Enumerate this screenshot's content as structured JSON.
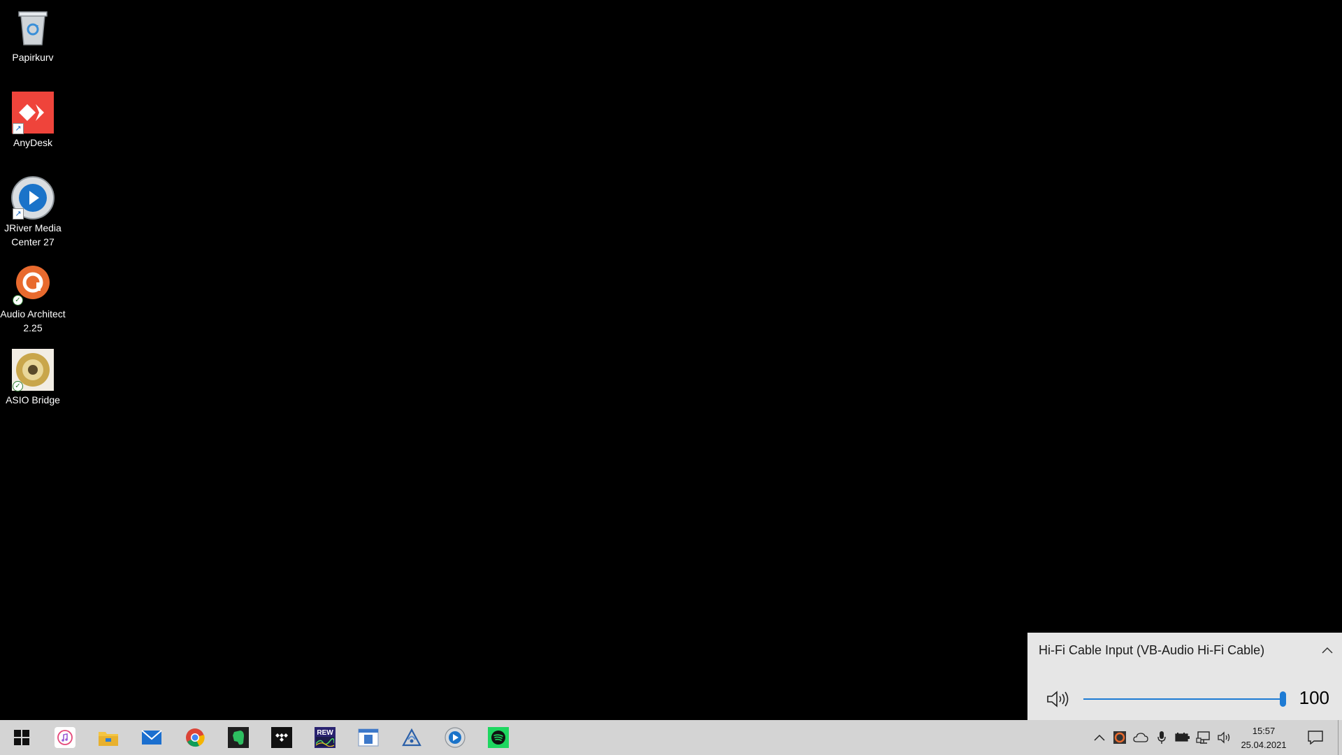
{
  "desktop": {
    "icons": [
      {
        "label": "Papirkurv"
      },
      {
        "label": "AnyDesk"
      },
      {
        "label": "JRiver Media Center 27"
      },
      {
        "label": "Audio Architect 2.25"
      },
      {
        "label": "ASIO Bridge"
      }
    ]
  },
  "volume_flyout": {
    "device_name": "Hi-Fi Cable Input (VB-Audio Hi-Fi Cable)",
    "volume": "100",
    "volume_fraction": 1.0,
    "accent_color": "#1e7bd4"
  },
  "taskbar": {
    "pinned_apps": [
      "windows-start-icon",
      "itunes-icon",
      "file-explorer-icon",
      "mail-icon",
      "chrome-icon",
      "evernote-icon",
      "tidal-icon",
      "rew-icon",
      "windows-app-icon",
      "audio-app-icon",
      "jriver-icon",
      "spotify-icon"
    ],
    "tray_icons": [
      "chevron-up-icon",
      "audio-architect-tray-icon",
      "onedrive-icon",
      "microphone-icon",
      "battery-icon",
      "network-icon",
      "speaker-icon"
    ],
    "rew_label": "REW",
    "clock": {
      "time": "15:57",
      "date": "25.04.2021"
    }
  },
  "colors": {
    "taskbar_bg": "#d4d4d4",
    "flyout_bg": "#e6e6e6",
    "desktop_bg": "#000000"
  }
}
